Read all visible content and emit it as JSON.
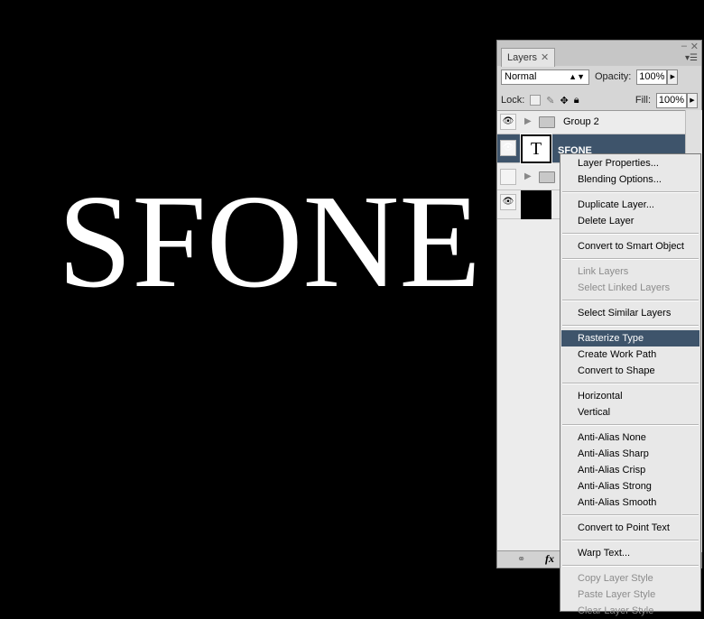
{
  "canvas": {
    "text": "SFONE"
  },
  "panel": {
    "tab_label": "Layers",
    "tab_close": "✕",
    "minimize": "–",
    "close": "✕",
    "menu_icon": "▾☰",
    "blend_mode": "Normal",
    "opacity_label": "Opacity:",
    "opacity": "100%",
    "lock_label": "Lock:",
    "fill_label": "Fill:",
    "fill": "100%",
    "layers": [
      {
        "name": "Group 2",
        "type": "group",
        "visible": true
      },
      {
        "name": "SFONE",
        "type": "text",
        "visible": true,
        "selected": true
      },
      {
        "name": "",
        "type": "group",
        "visible": false
      },
      {
        "name": "",
        "type": "fill",
        "visible": true
      }
    ],
    "bottom_icons": [
      "link-icon",
      "fx-icon"
    ],
    "fx_label": "fx"
  },
  "context_menu": {
    "items": [
      {
        "label": "Layer Properties...",
        "enabled": true
      },
      {
        "label": "Blending Options...",
        "enabled": true
      },
      {
        "sep": true
      },
      {
        "label": "Duplicate Layer...",
        "enabled": true
      },
      {
        "label": "Delete Layer",
        "enabled": true
      },
      {
        "sep": true
      },
      {
        "label": "Convert to Smart Object",
        "enabled": true
      },
      {
        "sep": true
      },
      {
        "label": "Link Layers",
        "enabled": false
      },
      {
        "label": "Select Linked Layers",
        "enabled": false
      },
      {
        "sep": true
      },
      {
        "label": "Select Similar Layers",
        "enabled": true
      },
      {
        "sep": true
      },
      {
        "label": "Rasterize Type",
        "enabled": true,
        "highlighted": true
      },
      {
        "label": "Create Work Path",
        "enabled": true
      },
      {
        "label": "Convert to Shape",
        "enabled": true
      },
      {
        "sep": true
      },
      {
        "label": "Horizontal",
        "enabled": true
      },
      {
        "label": "Vertical",
        "enabled": true
      },
      {
        "sep": true
      },
      {
        "label": "Anti-Alias None",
        "enabled": true
      },
      {
        "label": "Anti-Alias Sharp",
        "enabled": true
      },
      {
        "label": "Anti-Alias Crisp",
        "enabled": true
      },
      {
        "label": "Anti-Alias Strong",
        "enabled": true
      },
      {
        "label": "Anti-Alias Smooth",
        "enabled": true
      },
      {
        "sep": true
      },
      {
        "label": "Convert to Point Text",
        "enabled": true
      },
      {
        "sep": true
      },
      {
        "label": "Warp Text...",
        "enabled": true
      },
      {
        "sep": true
      },
      {
        "label": "Copy Layer Style",
        "enabled": false
      },
      {
        "label": "Paste Layer Style",
        "enabled": false
      },
      {
        "label": "Clear Layer Style",
        "enabled": false
      }
    ]
  },
  "colors": {
    "selection": "#3e546b",
    "background": "#000000"
  }
}
